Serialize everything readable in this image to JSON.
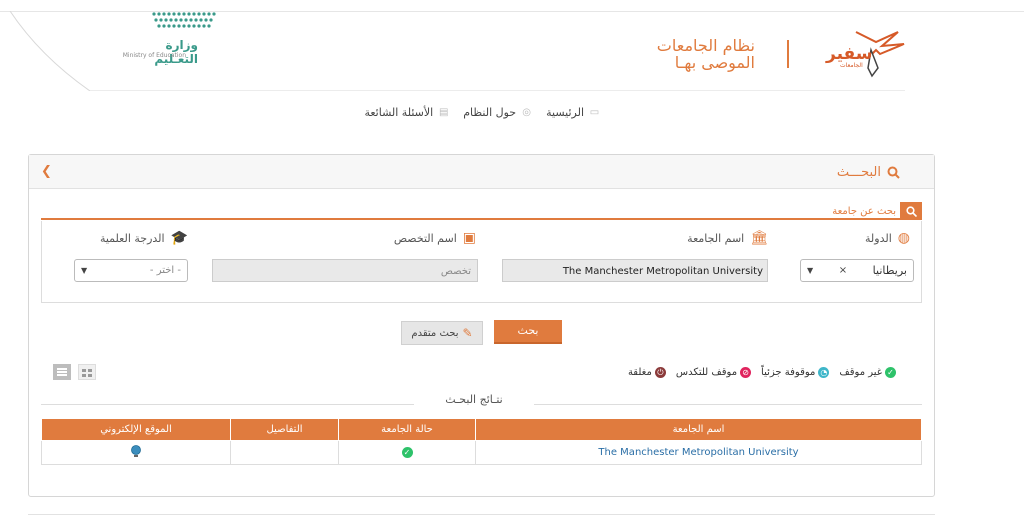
{
  "header": {
    "ministry_ar": "وزارة التعـليم",
    "ministry_en": "Ministry of Education",
    "system_title_line1": "نظام الجامعات",
    "system_title_line2": "الموصى بهـا",
    "safeer_name": "سفير",
    "safeer_sub": "الجامعات",
    "brand_color": "#e07b3e"
  },
  "nav": {
    "items": [
      {
        "label": "الرئيسية",
        "icon": "monitor-icon"
      },
      {
        "label": "حول النظام",
        "icon": "check-circle-icon"
      },
      {
        "label": "الأسئلة الشائعة",
        "icon": "chat-icon"
      }
    ]
  },
  "panel": {
    "title": "البحـــث",
    "tab_label": "بحث عن جامعة"
  },
  "form": {
    "country_label": "الدولة",
    "country_value": "بريطانيا",
    "university_label": "اسم الجامعة",
    "university_value": "The Manchester Metropolitan University",
    "specialization_label": "اسم التخصص",
    "specialization_placeholder": "تخصص",
    "degree_label": "الدرجة العلمية",
    "degree_value": "- اختر -",
    "search_button": "بحث",
    "advanced_button": "بحث متقدم"
  },
  "legend": {
    "items": [
      {
        "label": "غير موقف",
        "color": "#2ec26a"
      },
      {
        "label": "موقوفة جزئياً",
        "color": "#3fb6c9"
      },
      {
        "label": "موقف للتكدس",
        "color": "#e0245e"
      },
      {
        "label": "مغلقة",
        "color": "#8b3a3a"
      }
    ]
  },
  "results": {
    "title": "نتـائج البحـث",
    "columns": [
      "اسم الجامعة",
      "حالة الجامعة",
      "التفاصيل",
      "الموقع الإلكتروني"
    ],
    "rows": [
      {
        "name": "The Manchester Metropolitan University",
        "status": "غير موقف",
        "details": ""
      }
    ]
  }
}
